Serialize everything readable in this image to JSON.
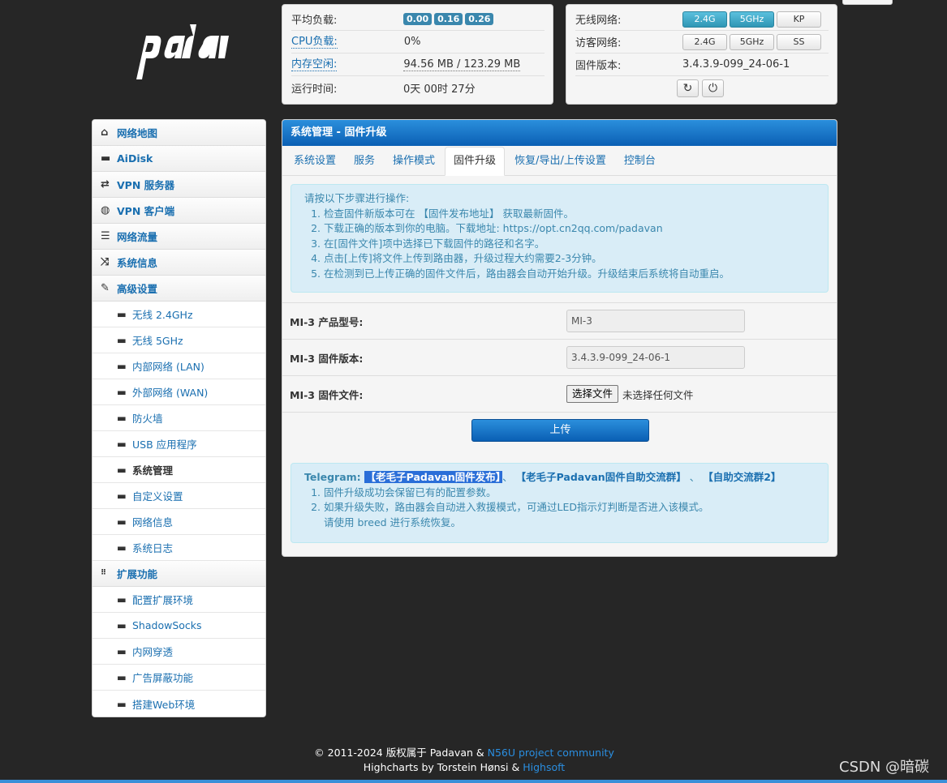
{
  "status": {
    "load_label": "平均负载:",
    "load_values": [
      "0.00",
      "0.16",
      "0.26"
    ],
    "cpu_label": "CPU负载:",
    "cpu_value": "0%",
    "mem_label": "内存空闲:",
    "mem_value": "94.56 MB / 123.29 MB",
    "uptime_label": "运行时间:",
    "uptime_value": "0天 00时 27分"
  },
  "wireless": {
    "wifi_label": "无线网络:",
    "wifi_buttons": [
      "2.4G",
      "5GHz",
      "KP"
    ],
    "guest_label": "访客网络:",
    "guest_buttons": [
      "2.4G",
      "5GHz",
      "SS"
    ],
    "fw_label": "固件版本:",
    "fw_value": "3.4.3.9-099_24-06-1",
    "refresh_icon": "↻",
    "power_icon": "⏻"
  },
  "sidebar": {
    "items": [
      {
        "label": "网络地图",
        "icon": "⌂"
      },
      {
        "label": "AiDisk",
        "icon": "▬"
      },
      {
        "label": "VPN 服务器",
        "icon": "⇄"
      },
      {
        "label": "VPN 客户端",
        "icon": "◍"
      },
      {
        "label": "网络流量",
        "icon": "☰"
      },
      {
        "label": "系统信息",
        "icon": "⤨"
      },
      {
        "label": "高级设置",
        "icon": "✎"
      }
    ],
    "advanced": [
      "无线 2.4GHz",
      "无线 5GHz",
      "内部网络 (LAN)",
      "外部网络 (WAN)",
      "防火墙",
      "USB 应用程序",
      "系统管理",
      "自定义设置",
      "网络信息",
      "系统日志"
    ],
    "ext_label": "扩展功能",
    "ext_icon": "⋮⋮⋮",
    "ext": [
      "配置扩展环境",
      "ShadowSocks",
      "内网穿透",
      "广告屏蔽功能",
      "搭建Web环境"
    ]
  },
  "main": {
    "title": "系统管理 - 固件升级",
    "tabs": [
      "系统设置",
      "服务",
      "操作模式",
      "固件升级",
      "恢复/导出/上传设置",
      "控制台"
    ],
    "steps_intro": "请按以下步骤进行操作:",
    "steps": [
      "检查固件新版本可在 【固件发布地址】 获取最新固件。",
      "下载正确的版本到你的电脑。下载地址: https://opt.cn2qq.com/padavan",
      "在[固件文件]项中选择已下载固件的路径和名字。",
      "点击[上传]将文件上传到路由器，升级过程大约需要2-3分钟。",
      "在检测到已上传正确的固件文件后，路由器会自动开始升级。升级结束后系统将自动重启。"
    ],
    "model_label": "MI-3 产品型号:",
    "model_value": "MI-3",
    "version_label": "MI-3 固件版本:",
    "version_value": "3.4.3.9-099_24-06-1",
    "file_label": "MI-3 固件文件:",
    "file_button": "选择文件",
    "file_none": "未选择任何文件",
    "upload_label": "上传",
    "tg_label": "Telegram:",
    "tg_link1": "【老毛子Padavan固件发布】",
    "tg_sep1": "、",
    "tg_link2": "【老毛子Padavan固件自助交流群】",
    "tg_sep2": "、",
    "tg_link3": "【自助交流群2】",
    "notes": [
      "固件升级成功会保留已有的配置参数。",
      "如果升级失败，路由器会自动进入救援模式，可通过LED指示灯判断是否进入该模式。"
    ],
    "note_extra": "请使用 breed 进行系统恢复。"
  },
  "footer": {
    "line1_prefix": "© 2011-2024 版权属于 Padavan & ",
    "line1_link": "N56U project community",
    "line2_prefix": "Highcharts by Torstein Hønsi & ",
    "line2_link": "Highsoft"
  },
  "watermark": "CSDN @暗碳"
}
